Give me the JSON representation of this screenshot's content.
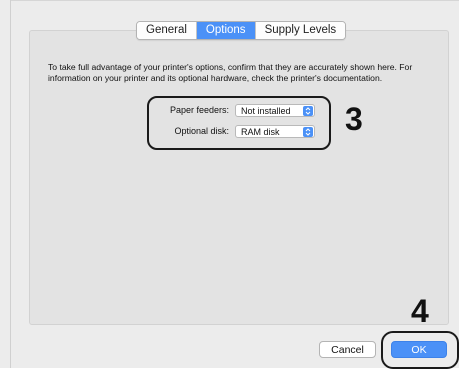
{
  "tabs": [
    "General",
    "Options",
    "Supply Levels"
  ],
  "active_tab": "Options",
  "description": "To take full advantage of your printer's options, confirm that they are accurately shown here. For information on your printer and its optional hardware, check the printer's documentation.",
  "options": {
    "paper_feeders": {
      "label": "Paper feeders:",
      "value": "Not installed"
    },
    "optional_disk": {
      "label": "Optional disk:",
      "value": "RAM disk"
    }
  },
  "callouts": {
    "step3": "3",
    "step4": "4"
  },
  "buttons": {
    "cancel": "Cancel",
    "ok": "OK"
  },
  "colors": {
    "accent": "#4b91f7",
    "highlight_ring": "#1a1a1a"
  },
  "icons": {
    "stepper": "updown-stepper-icon"
  }
}
